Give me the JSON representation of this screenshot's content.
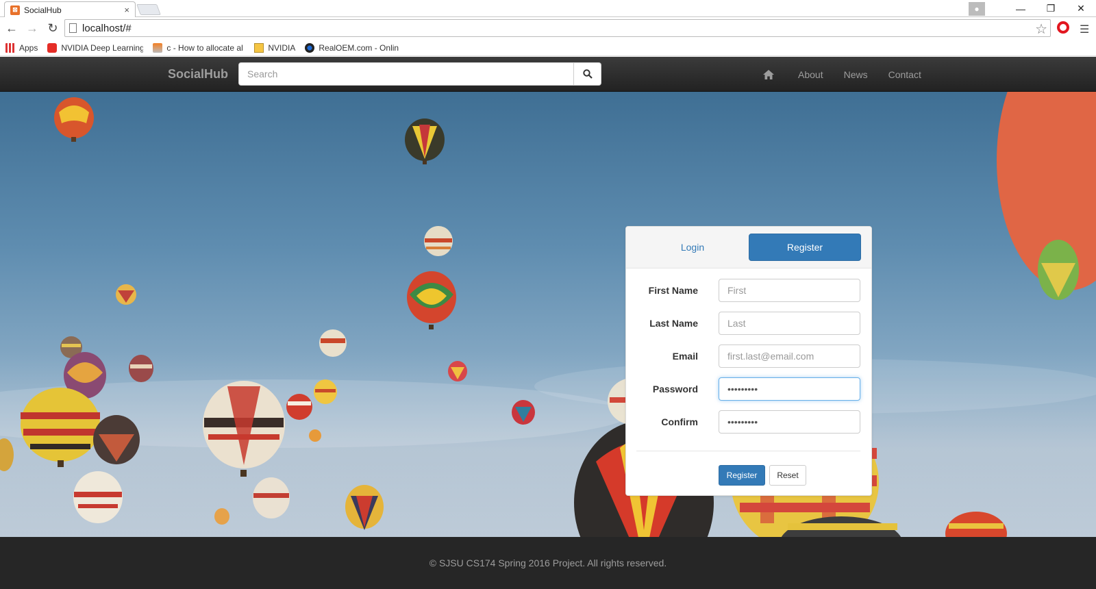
{
  "browser": {
    "tab_title": "SocialHub",
    "tab_close": "×",
    "url": "localhost/#",
    "bookmarks": [
      {
        "label": "Apps",
        "icon": "apps-grid-icon"
      },
      {
        "label": "NVIDIA Deep Learning",
        "icon": "youtube-icon"
      },
      {
        "label": "c - How to allocate al",
        "icon": "stackoverflow-icon"
      },
      {
        "label": "NVIDIA",
        "icon": "folder-icon"
      },
      {
        "label": "RealOEM.com - Onlin",
        "icon": "bmw-icon"
      }
    ]
  },
  "navbar": {
    "brand": "SocialHub",
    "search_placeholder": "Search",
    "links": [
      "About",
      "News",
      "Contact"
    ]
  },
  "panel": {
    "tabs": {
      "login": "Login",
      "register": "Register"
    },
    "fields": {
      "first_name": {
        "label": "First Name",
        "placeholder": "First",
        "value": ""
      },
      "last_name": {
        "label": "Last Name",
        "placeholder": "Last",
        "value": ""
      },
      "email": {
        "label": "Email",
        "placeholder": "first.last@email.com",
        "value": ""
      },
      "password": {
        "label": "Password",
        "value": "•••••••••"
      },
      "confirm": {
        "label": "Confirm",
        "value": "•••••••••"
      }
    },
    "buttons": {
      "register": "Register",
      "reset": "Reset"
    }
  },
  "footer": {
    "text": "© SJSU CS174 Spring 2016 Project. All rights reserved."
  },
  "colors": {
    "primary": "#337ab7",
    "navbar": "#222222",
    "footer": "#262626"
  }
}
